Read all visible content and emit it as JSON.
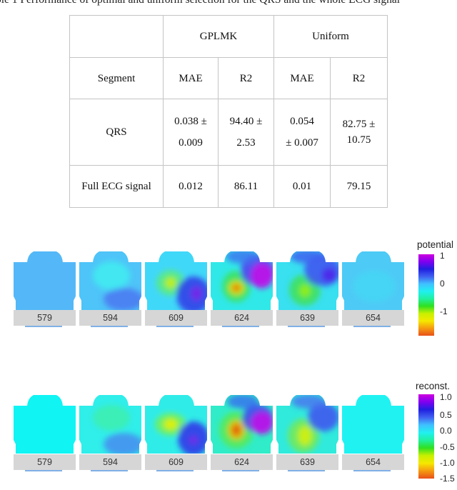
{
  "caption": "ble 1 Performance of optimal and uniform selection for the QRS and the whole ECG signal",
  "table": {
    "group_headers": [
      "",
      "GPLMK",
      "Uniform"
    ],
    "column_headers": [
      "Segment",
      "MAE",
      "R2",
      "MAE",
      "R2"
    ],
    "rows": [
      {
        "segment": "QRS",
        "cells": [
          [
            "0.038 ±",
            "0.009"
          ],
          [
            "94.40 ±",
            "2.53"
          ],
          [
            "0.054",
            "± 0.007"
          ],
          [
            "82.75 ±",
            "10.75"
          ]
        ]
      },
      {
        "segment": "Full ECG signal",
        "cells": [
          [
            "0.012"
          ],
          [
            "86.11"
          ],
          [
            "0.01"
          ],
          [
            "79.15"
          ]
        ]
      }
    ]
  },
  "figure": {
    "rows": [
      {
        "name": "potential",
        "frames": [
          "579",
          "594",
          "609",
          "624",
          "639",
          "654"
        ],
        "legend": {
          "title": "potential",
          "ticks": [
            "1",
            "0",
            "-1"
          ],
          "range": [
            -1.6,
            1.1
          ]
        }
      },
      {
        "name": "reconstructed",
        "frames": [
          "579",
          "594",
          "609",
          "624",
          "639",
          "654"
        ],
        "legend": {
          "title": "reconst.",
          "ticks": [
            "1.0",
            "0.5",
            "0.0",
            "-0.5",
            "-1.0",
            "-1.5"
          ],
          "range": [
            -1.5,
            1.0
          ]
        }
      }
    ],
    "colormap": [
      "#e8501a",
      "#f59a10",
      "#f5e800",
      "#c8f000",
      "#30e020",
      "#20f0a0",
      "#20f0f0",
      "#40c0ff",
      "#4060f0",
      "#2020e0",
      "#8000f0",
      "#d000e0"
    ]
  }
}
